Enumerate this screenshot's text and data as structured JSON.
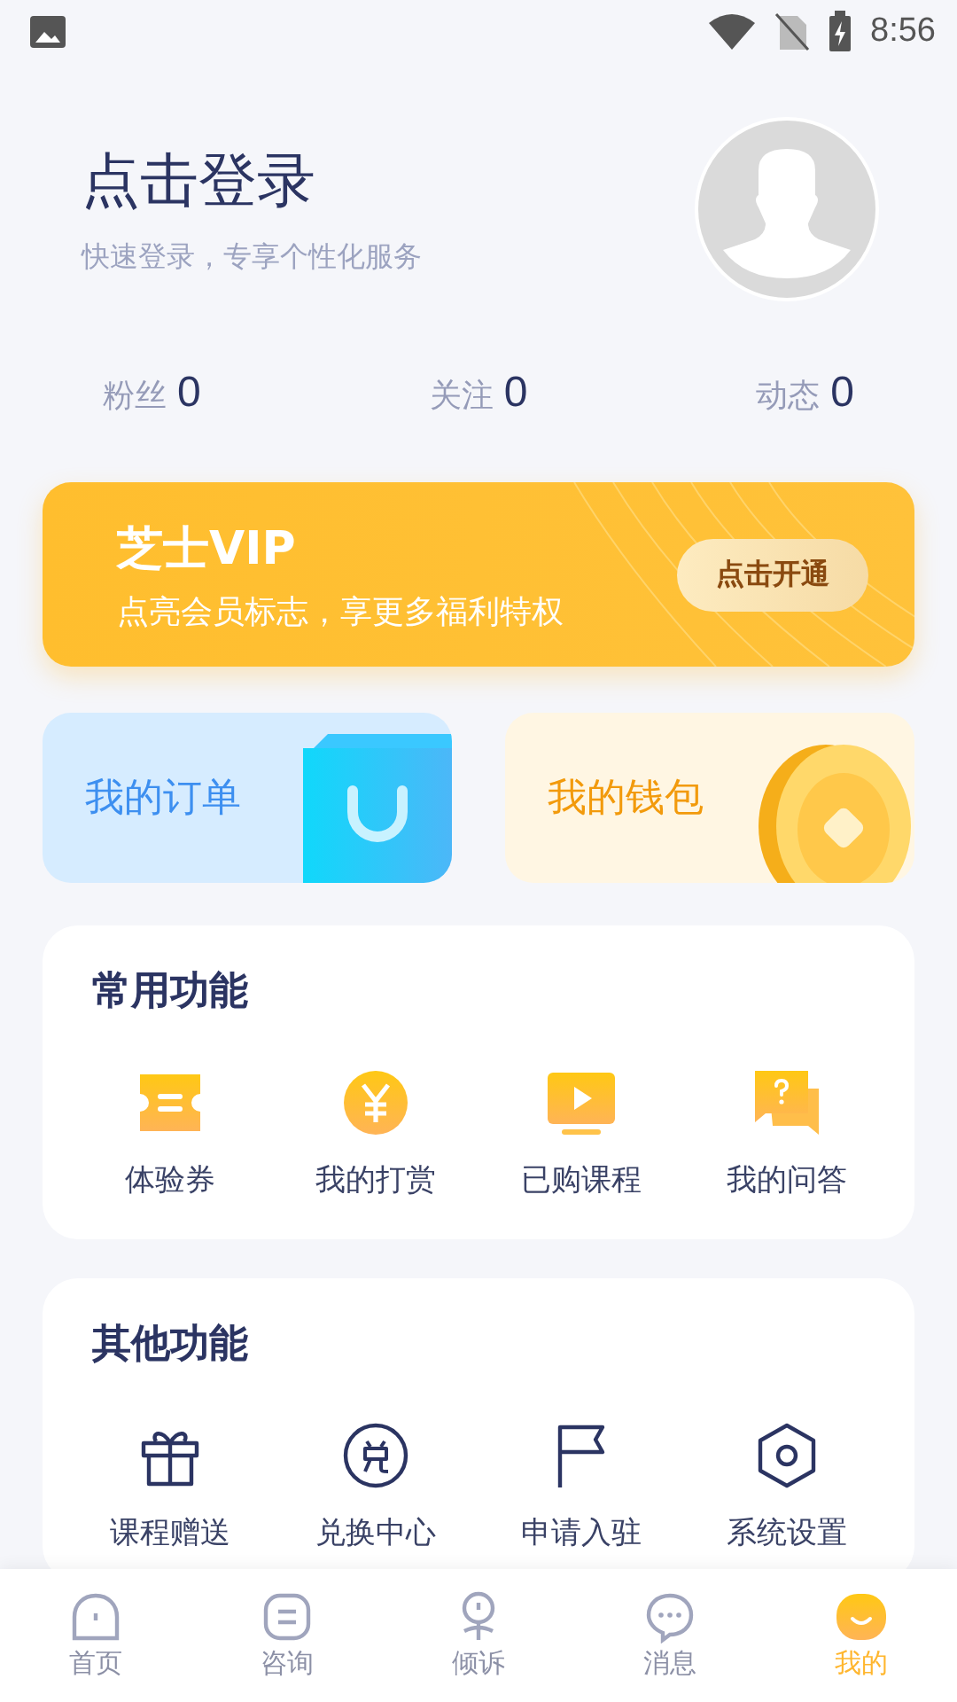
{
  "status_bar": {
    "time": "8:56"
  },
  "profile": {
    "title": "点击登录",
    "subtitle": "快速登录，专享个性化服务"
  },
  "stats": [
    {
      "label": "粉丝",
      "value": "0"
    },
    {
      "label": "关注",
      "value": "0"
    },
    {
      "label": "动态",
      "value": "0"
    }
  ],
  "vip": {
    "title": "芝士VIP",
    "subtitle": "点亮会员标志，享更多福利特权",
    "button": "点击开通"
  },
  "shortcuts": [
    {
      "kind": "order",
      "label": "我的订单"
    },
    {
      "kind": "wallet",
      "label": "我的钱包"
    }
  ],
  "sections": [
    {
      "title": "常用功能",
      "items": [
        {
          "kind": "ticket",
          "label": "体验券"
        },
        {
          "kind": "yen",
          "label": "我的打赏"
        },
        {
          "kind": "video",
          "label": "已购课程"
        },
        {
          "kind": "question",
          "label": "我的问答"
        }
      ]
    },
    {
      "title": "其他功能",
      "items": [
        {
          "kind": "gift",
          "label": "课程赠送"
        },
        {
          "kind": "exchange",
          "label": "兑换中心"
        },
        {
          "kind": "flag",
          "label": "申请入驻"
        },
        {
          "kind": "settings",
          "label": "系统设置"
        }
      ]
    }
  ],
  "tab_bar": [
    {
      "kind": "home",
      "label": "首页",
      "selected": false
    },
    {
      "kind": "consult",
      "label": "咨询",
      "selected": false
    },
    {
      "kind": "confide",
      "label": "倾诉",
      "selected": false
    },
    {
      "kind": "message",
      "label": "消息",
      "selected": false
    },
    {
      "kind": "mine",
      "label": "我的",
      "selected": true
    }
  ]
}
